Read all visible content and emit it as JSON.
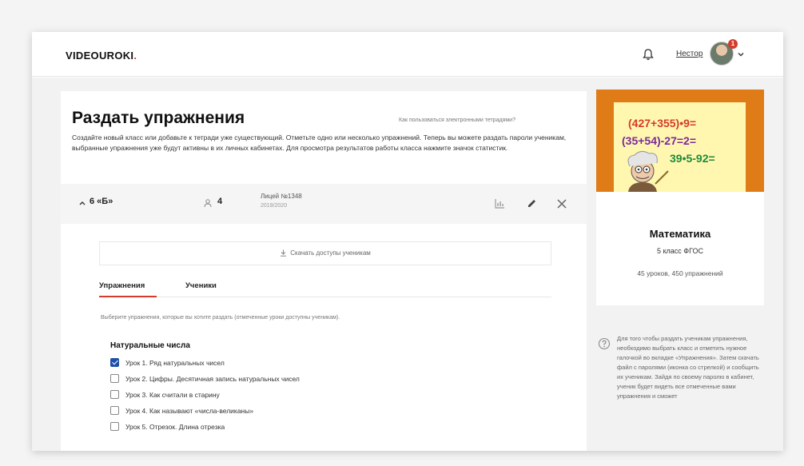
{
  "header": {
    "logo_main": "VIDEOUROKI",
    "logo_suffix": ".",
    "user_name": "Нестор",
    "notification_count": "1"
  },
  "page": {
    "title": "Раздать упражнения",
    "help_link": "Как пользоваться электронными тетрадями?",
    "description": "Создайте новый класс или добавьте к тетради уже существующий. Отметьте одно или несколько упражнений. Теперь вы можете раздать пароли ученикам, выбранные упражнения уже будут активны в их личных кабинетах. Для просмотра результатов работы класса нажмите значок статистик."
  },
  "class_row": {
    "name": "6 «Б»",
    "students": "4",
    "school": "Лицей №1348",
    "year": "2019/2020"
  },
  "download_button": "Скачать доступы ученикам",
  "tabs": [
    "Упражнения",
    "Ученики"
  ],
  "hint": "Выберите упражнения, которые вы хотите раздать (отмеченные уроки доступны ученикам).",
  "section": {
    "title": "Натуральные числа",
    "lessons": [
      {
        "label": "Урок 1. Ряд натуральных чисел",
        "checked": true
      },
      {
        "label": "Урок 2. Цифры. Десятичная запись натуральных чисел",
        "checked": false
      },
      {
        "label": "Урок 3. Как считали в старину",
        "checked": false
      },
      {
        "label": "Урок 4. Как называют «числа-великаны»",
        "checked": false
      },
      {
        "label": "Урок 5. Отрезок. Длина отрезка",
        "checked": false
      }
    ]
  },
  "sidebar": {
    "cover_lines": [
      "(427+355)•9=",
      "(35+54)-27=2=",
      "39•5-92="
    ],
    "subject": "Математика",
    "grade": "5 класс ФГОС",
    "stats": "45 уроков, 450 упражнений",
    "info": "Для того чтобы раздать ученикам упражнения, необходимо выбрать класс и отметить нужное галочкой во вкладке «Упражнения». Затем скачать файл с паролями (иконка со стрелкой) и сообщить их ученикам. Зайдя по своему паролю в кабинет, ученик будет видеть все отмеченные вами упражнения и сможет"
  },
  "colors": {
    "accent": "#d63b2c",
    "checkbox": "#1f4fa8",
    "cover": "#e07c18"
  }
}
